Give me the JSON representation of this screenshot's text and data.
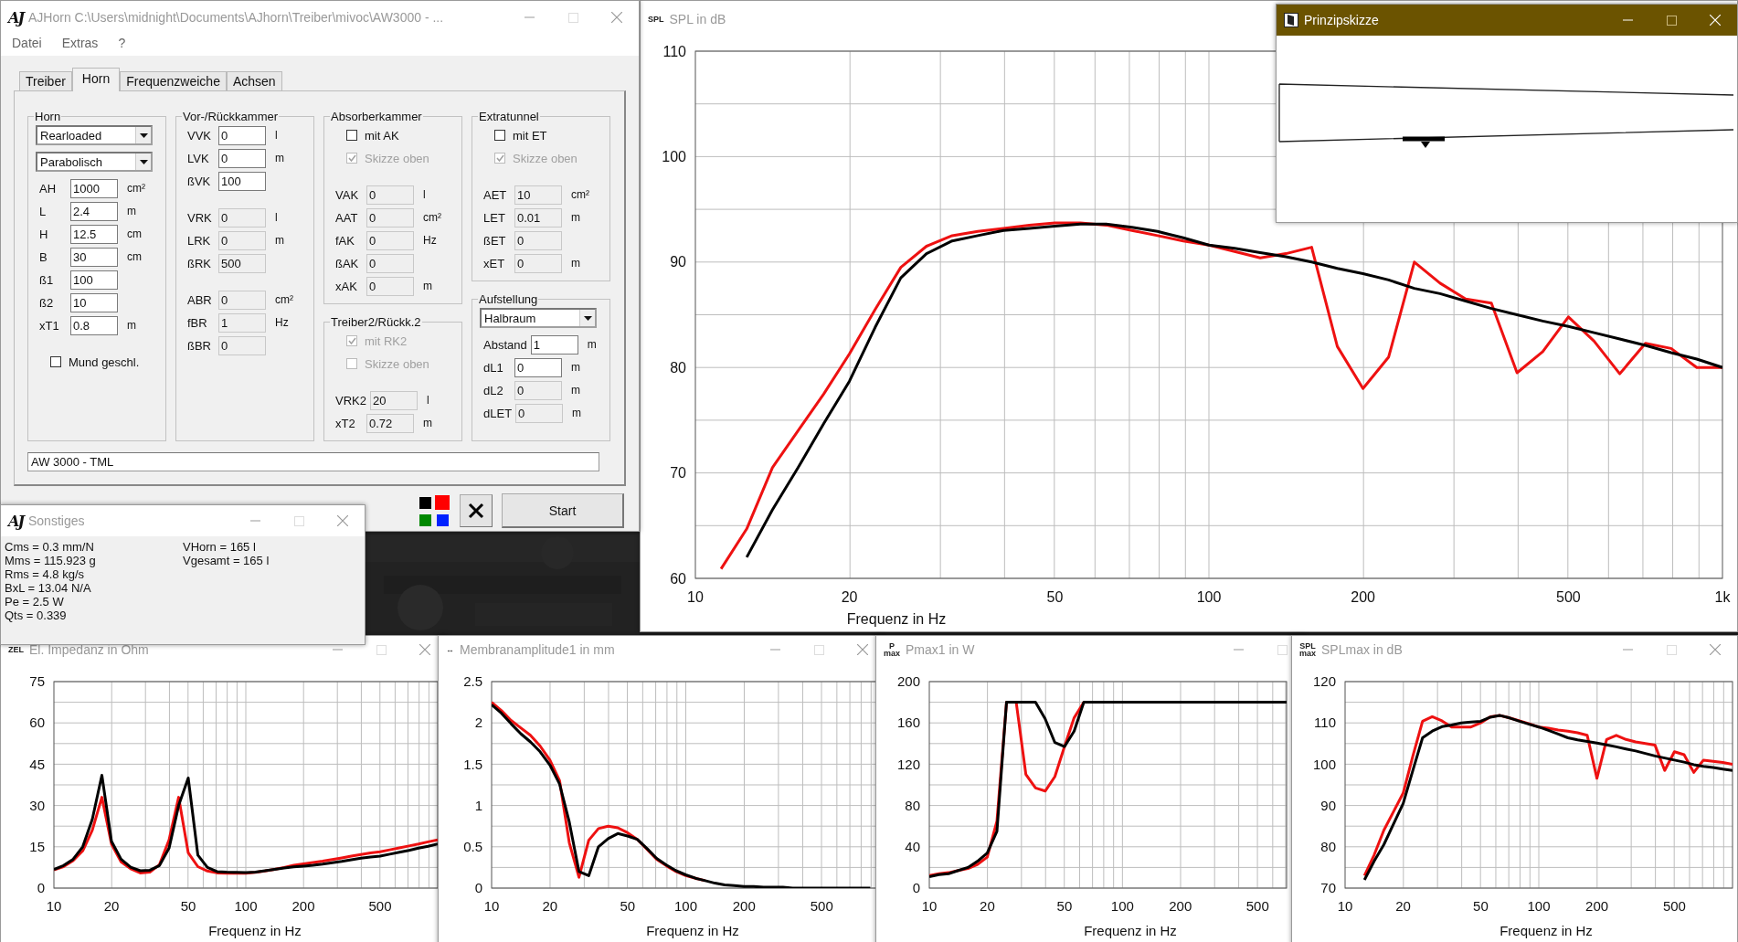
{
  "main_window": {
    "logo": "AJ",
    "title": "AJHorn  C:\\Users\\midnight\\Documents\\AJhorn\\Treiber\\mivoc\\AW3000 - ...",
    "menu": [
      "Datei",
      "Extras",
      "?"
    ],
    "tabs": [
      {
        "label": "Treiber",
        "selected": false
      },
      {
        "label": "Horn",
        "selected": true
      },
      {
        "label": "Frequenzweiche",
        "selected": false
      },
      {
        "label": "Achsen",
        "selected": false
      }
    ],
    "columns": [
      [
        {
          "title": "Horn",
          "sections": [
            [
              {
                "kind": "select",
                "value": "Rearloaded"
              },
              {
                "kind": "select",
                "value": "Parabolisch"
              },
              {
                "kind": "field",
                "label": "AH",
                "value": "1000",
                "unit": "cm²",
                "disabled": false
              },
              {
                "kind": "field",
                "label": "L",
                "value": "2.4",
                "unit": "m",
                "disabled": false
              },
              {
                "kind": "field",
                "label": "H",
                "value": "12.5",
                "unit": "cm",
                "disabled": false
              },
              {
                "kind": "field",
                "label": "B",
                "value": "30",
                "unit": "cm",
                "disabled": false
              },
              {
                "kind": "field",
                "label": "ß1",
                "value": "100",
                "disabled": false
              },
              {
                "kind": "field",
                "label": "ß2",
                "value": "10",
                "disabled": false
              },
              {
                "kind": "field",
                "label": "xT1",
                "value": "0.8",
                "unit": "m",
                "disabled": false
              }
            ],
            [
              {
                "kind": "check",
                "label": "Mund geschl.",
                "checked": false,
                "disabled": false
              }
            ]
          ]
        }
      ],
      [
        {
          "title": "Vor-/Rückkammer",
          "sections": [
            [
              {
                "kind": "field",
                "label": "VVK",
                "value": "0",
                "unit": "l",
                "disabled": false
              },
              {
                "kind": "field",
                "label": "LVK",
                "value": "0",
                "unit": "m",
                "disabled": false
              },
              {
                "kind": "field",
                "label": "ßVK",
                "value": "100",
                "disabled": false
              }
            ],
            [
              {
                "kind": "field",
                "label": "VRK",
                "value": "0",
                "unit": "l",
                "disabled": true
              },
              {
                "kind": "field",
                "label": "LRK",
                "value": "0",
                "unit": "m",
                "disabled": true
              },
              {
                "kind": "field",
                "label": "ßRK",
                "value": "500",
                "disabled": true
              }
            ],
            [
              {
                "kind": "field",
                "label": "ABR",
                "value": "0",
                "unit": "cm²",
                "disabled": true
              },
              {
                "kind": "field",
                "label": "fBR",
                "value": "1",
                "unit": "Hz",
                "disabled": true
              },
              {
                "kind": "field",
                "label": "ßBR",
                "value": "0",
                "disabled": true
              }
            ]
          ]
        }
      ],
      [
        {
          "title": "Absorberkammer",
          "sections": [
            [
              {
                "kind": "check",
                "label": "mit AK",
                "checked": false,
                "disabled": false
              },
              {
                "kind": "check",
                "label": "Skizze oben",
                "checked": true,
                "disabled": true
              }
            ],
            [
              {
                "kind": "field",
                "label": "VAK",
                "value": "0",
                "unit": "l",
                "disabled": true
              },
              {
                "kind": "field",
                "label": "AAT",
                "value": "0",
                "unit": "cm²",
                "disabled": true
              },
              {
                "kind": "field",
                "label": "fAK",
                "value": "0",
                "unit": "Hz",
                "disabled": true
              },
              {
                "kind": "field",
                "label": "ßAK",
                "value": "0",
                "disabled": true
              },
              {
                "kind": "field",
                "label": "xAK",
                "value": "0",
                "unit": "m",
                "disabled": true
              }
            ]
          ]
        },
        {
          "title": "Treiber2/Rückk.2",
          "sections": [
            [
              {
                "kind": "check",
                "label": "mit RK2",
                "checked": true,
                "disabled": true
              },
              {
                "kind": "check",
                "label": "Skizze oben",
                "checked": false,
                "disabled": true
              }
            ],
            [
              {
                "kind": "field",
                "label": "VRK2",
                "value": "20",
                "unit": "l",
                "disabled": true
              },
              {
                "kind": "field",
                "label": "xT2",
                "value": "0.72",
                "unit": "m",
                "disabled": true
              }
            ]
          ]
        }
      ],
      [
        {
          "title": "Extratunnel",
          "sections": [
            [
              {
                "kind": "check",
                "label": "mit ET",
                "checked": false,
                "disabled": false
              },
              {
                "kind": "check",
                "label": "Skizze oben",
                "checked": true,
                "disabled": true
              }
            ],
            [
              {
                "kind": "field",
                "label": "AET",
                "value": "10",
                "unit": "cm²",
                "disabled": true
              },
              {
                "kind": "field",
                "label": "LET",
                "value": "0.01",
                "unit": "m",
                "disabled": true
              },
              {
                "kind": "field",
                "label": "ßET",
                "value": "0",
                "disabled": true
              },
              {
                "kind": "field",
                "label": "xET",
                "value": "0",
                "unit": "m",
                "disabled": true
              }
            ]
          ]
        },
        {
          "title": "Aufstellung",
          "sections": [
            [
              {
                "kind": "select",
                "value": "Halbraum"
              },
              {
                "kind": "field",
                "label": "Abstand",
                "value": "1",
                "unit": "m",
                "disabled": false
              },
              {
                "kind": "field",
                "label": "dL1",
                "value": "0",
                "unit": "m",
                "disabled": false
              },
              {
                "kind": "field",
                "label": "dL2",
                "value": "0",
                "unit": "m",
                "disabled": true
              },
              {
                "kind": "field",
                "label": "dLET",
                "value": "0",
                "unit": "m",
                "disabled": true
              }
            ]
          ]
        }
      ]
    ],
    "name_field": "AW 3000 - TML",
    "start_button": "Start"
  },
  "info_window": {
    "logo": "AJ",
    "title": "Sonstiges",
    "left_lines": [
      "Cms = 0.3 mm/N",
      "Mms = 115.923 g",
      "Rms = 4.8 kg/s",
      "BxL = 13.04 N/A",
      "Pe = 2.5 W",
      "Qts = 0.339"
    ],
    "right_lines": [
      "VHorn = 165 l",
      "Vgesamt = 165 l"
    ]
  },
  "spl_window": {
    "icon_lines": [
      "SPL"
    ],
    "title": "SPL in dB",
    "chart_data": {
      "type": "line",
      "grid": true,
      "xlabel": "Frequenz in Hz",
      "ylim": [
        60,
        110
      ],
      "yticks": [
        60,
        70,
        80,
        90,
        100,
        110
      ],
      "categories": [
        "10",
        null,
        null,
        null,
        null,
        null,
        "20",
        null,
        null,
        null,
        null,
        null,
        null,
        null,
        "50",
        null,
        null,
        null,
        null,
        null,
        "100",
        null,
        null,
        null,
        null,
        null,
        "200",
        null,
        null,
        null,
        null,
        null,
        null,
        null,
        "500",
        null,
        null,
        null,
        null,
        null,
        "1k"
      ],
      "series": [
        {
          "color": "#ee1111",
          "values": [
            null,
            60.9,
            64.7,
            70.5,
            74,
            77.5,
            81.3,
            85.5,
            89.5,
            91.5,
            92.5,
            92.9,
            93.2,
            93.5,
            93.7,
            93.7,
            93.5,
            93,
            92.5,
            92,
            91.6,
            91,
            90.4,
            90.8,
            91.4,
            82,
            78,
            81,
            90,
            88,
            86.5,
            86.1,
            79.5,
            81.5,
            84.8,
            82.5,
            79.4,
            82.3,
            81.8,
            80,
            80
          ]
        },
        {
          "color": "#000000",
          "values": [
            null,
            null,
            62,
            66.5,
            70.5,
            74.7,
            78.7,
            83.8,
            88.5,
            90.8,
            92,
            92.5,
            93,
            93.2,
            93.4,
            93.6,
            93.6,
            93.3,
            92.9,
            92.3,
            91.6,
            91.3,
            90.9,
            90.5,
            90,
            89.4,
            88.9,
            88.3,
            87.5,
            87,
            86.3,
            85.6,
            85,
            84.4,
            83.9,
            83.3,
            82.7,
            82.1,
            81.4,
            80.8,
            80
          ]
        }
      ]
    }
  },
  "sketch_window": {
    "title": "Prinzipskizze"
  },
  "charts": [
    {
      "icon_lines": [
        "ZEL"
      ],
      "title": "El. Impedanz in Ohm",
      "chart_data": {
        "type": "line",
        "grid": true,
        "xlabel": "Frequenz in Hz",
        "ylim": [
          0,
          75
        ],
        "yticks": [
          0,
          15,
          30,
          45,
          60,
          75
        ],
        "categories": [
          "10",
          null,
          null,
          null,
          null,
          null,
          "20",
          null,
          null,
          null,
          null,
          null,
          null,
          null,
          "50",
          null,
          null,
          null,
          null,
          null,
          "100",
          null,
          null,
          null,
          null,
          null,
          "200",
          null,
          null,
          null,
          null,
          null,
          null,
          null,
          "500",
          null,
          null,
          null,
          null,
          null,
          null
        ],
        "series": [
          {
            "color": "#ee1111",
            "values": [
              6.6,
              7.8,
              10,
              13.5,
              21,
              33,
              16,
              9.5,
              7,
              5.5,
              5.8,
              8.5,
              17.5,
              33,
              12.8,
              7.8,
              6.2,
              5.5,
              5.4,
              5.4,
              5.4,
              5.7,
              6.2,
              6.8,
              7.5,
              8.3,
              8.8,
              9.3,
              9.8,
              10.4,
              11,
              11.6,
              12.2,
              12.8,
              13.2,
              13.9,
              14.6,
              15.3,
              16,
              16.8,
              17.5
            ]
          },
          {
            "color": "#000000",
            "values": [
              6.8,
              8.2,
              10.5,
              15,
              25,
              41,
              17,
              10.5,
              7.6,
              6.3,
              6.5,
              8.2,
              14.5,
              30,
              40,
              12,
              7.5,
              6,
              5.8,
              5.7,
              5.6,
              5.8,
              6.3,
              6.8,
              7.3,
              7.7,
              8,
              8.3,
              8.7,
              9.2,
              9.7,
              10.3,
              10.9,
              11.3,
              11.6,
              12.3,
              13,
              13.7,
              14.5,
              15.2,
              16
            ]
          }
        ]
      }
    },
    {
      "icon_lines": [
        "↔"
      ],
      "title": "Membranamplitude1 in mm",
      "chart_data": {
        "type": "line",
        "grid": true,
        "xlabel": "Frequenz in Hz",
        "ylim": [
          0,
          2.5
        ],
        "yticks": [
          0,
          0.5,
          1,
          1.5,
          2,
          2.5
        ],
        "categories": [
          "10",
          null,
          null,
          null,
          null,
          null,
          "20",
          null,
          null,
          null,
          null,
          null,
          null,
          null,
          "50",
          null,
          null,
          null,
          null,
          null,
          "100",
          null,
          null,
          null,
          null,
          null,
          "200",
          null,
          null,
          null,
          null,
          null,
          null,
          null,
          "500",
          null,
          null,
          null,
          null,
          null,
          null
        ],
        "series": [
          {
            "color": "#ee1111",
            "values": [
              2.25,
              2.15,
              2.03,
              1.94,
              1.85,
              1.72,
              1.55,
              1.3,
              0.55,
              0.13,
              0.58,
              0.72,
              0.75,
              0.73,
              0.67,
              0.59,
              0.47,
              0.35,
              0.27,
              0.2,
              0.15,
              0.12,
              0.09,
              null,
              null,
              null,
              null,
              null,
              null,
              null,
              null,
              null,
              null,
              null,
              null,
              null,
              null,
              null,
              null,
              null,
              null
            ]
          },
          {
            "color": "#000000",
            "values": [
              2.22,
              2.12,
              1.99,
              1.87,
              1.77,
              1.65,
              1.49,
              1.26,
              0.8,
              0.2,
              0.15,
              0.5,
              0.6,
              0.66,
              0.63,
              0.59,
              0.48,
              0.36,
              0.28,
              0.21,
              0.16,
              0.12,
              0.09,
              0.06,
              0.04,
              0.03,
              0.02,
              0.02,
              0.01,
              0.01,
              0.01,
              0,
              0,
              0,
              0,
              0,
              0,
              0,
              0,
              0,
              null
            ]
          }
        ]
      }
    },
    {
      "icon_lines": [
        "P",
        "max"
      ],
      "title": "Pmax1 in W",
      "chart_data": {
        "type": "line",
        "grid": true,
        "xlabel": "Frequenz in Hz",
        "ylim": [
          0,
          200
        ],
        "yticks": [
          0,
          40,
          80,
          120,
          160,
          200
        ],
        "categories": [
          "10",
          null,
          null,
          null,
          null,
          null,
          "20",
          null,
          null,
          null,
          null,
          null,
          null,
          null,
          "50",
          null,
          null,
          null,
          null,
          null,
          "100",
          null,
          null,
          null,
          null,
          null,
          "200",
          null,
          null,
          null,
          null,
          null,
          null,
          null,
          "500",
          null,
          null,
          null
        ],
        "series": [
          {
            "color": "#ee1111",
            "values": [
              12,
              14,
              15,
              17,
              19,
              23,
              30,
              65,
              180,
              180,
              110,
              97,
              94,
              108,
              137,
              165,
              180,
              null,
              null,
              null,
              null,
              null,
              null,
              null,
              null,
              null,
              null,
              null,
              null,
              null,
              null,
              null,
              null,
              null,
              null,
              null,
              null,
              null
            ]
          },
          {
            "color": "#000000",
            "values": [
              11,
              13,
              14,
              17,
              20,
              26,
              34,
              55,
              180,
              180,
              180,
              180,
              164,
              141,
              137,
              152,
              180,
              180,
              180,
              180,
              180,
              180,
              180,
              180,
              180,
              180,
              180,
              180,
              180,
              180,
              180,
              180,
              180,
              180,
              180,
              180,
              180,
              180
            ]
          }
        ]
      }
    },
    {
      "icon_lines": [
        "SPL",
        "max"
      ],
      "title": "SPLmax in dB",
      "chart_data": {
        "type": "line",
        "grid": true,
        "xlabel": "Frequenz in Hz",
        "ylim": [
          70,
          120
        ],
        "yticks": [
          70,
          80,
          90,
          100,
          110,
          120
        ],
        "categories": [
          "10",
          null,
          null,
          null,
          null,
          null,
          "20",
          null,
          null,
          null,
          null,
          null,
          null,
          null,
          "50",
          null,
          null,
          null,
          null,
          null,
          "100",
          null,
          null,
          null,
          null,
          null,
          "200",
          null,
          null,
          null,
          null,
          null,
          null,
          null,
          "500",
          null,
          null,
          null,
          null,
          null,
          null
        ],
        "series": [
          {
            "color": "#ee1111",
            "values": [
              null,
              null,
              73,
              78,
              84,
              88.5,
              93,
              102,
              110.4,
              111.5,
              110.5,
              109,
              109,
              109,
              110,
              111.5,
              111.8,
              111.2,
              110.5,
              109.8,
              109,
              108.7,
              108.3,
              108,
              107.6,
              107,
              96.6,
              106,
              107,
              106,
              105.4,
              105,
              104.6,
              98.5,
              103,
              102.3,
              98,
              101,
              100.7,
              100.4,
              100
            ]
          },
          {
            "color": "#000000",
            "values": [
              null,
              null,
              72,
              76.5,
              80.5,
              85.5,
              90.5,
              98.5,
              106.4,
              108,
              109.1,
              109.5,
              110,
              110.2,
              110.4,
              111.4,
              111.8,
              111.2,
              110.4,
              109.7,
              109,
              108.2,
              107.3,
              106.4,
              105.9,
              105.5,
              105.1,
              104.7,
              104.2,
              103.7,
              103.2,
              102.6,
              102,
              101.5,
              101,
              100.5,
              99.9,
              99.5,
              99.2,
              98.8,
              98.5
            ]
          }
        ]
      }
    }
  ]
}
